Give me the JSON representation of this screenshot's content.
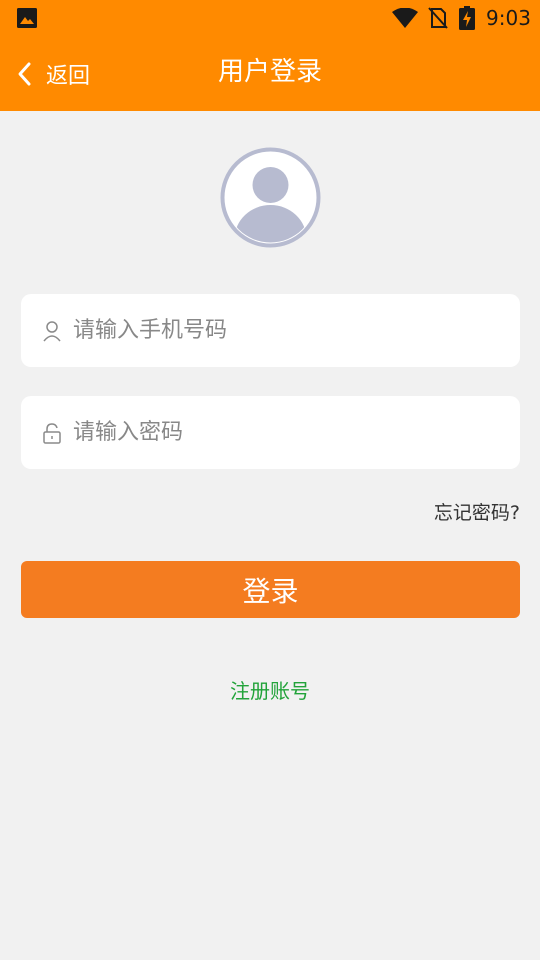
{
  "status_bar": {
    "time": "9:03",
    "icons": [
      "gallery-icon",
      "wifi-icon",
      "no-sim-icon",
      "battery-charging-icon"
    ]
  },
  "nav": {
    "back_label": "返回",
    "title": "用户登录"
  },
  "form": {
    "phone_placeholder": "请输入手机号码",
    "phone_value": "",
    "password_placeholder": "请输入密码",
    "password_value": "",
    "forgot_label": "忘记密码?",
    "login_label": "登录",
    "register_label": "注册账号"
  },
  "colors": {
    "header": "#ff8a00",
    "button": "#f47c20",
    "background": "#f1f1f1",
    "link_green": "#22a33a",
    "avatar": "#b7bbd0"
  }
}
